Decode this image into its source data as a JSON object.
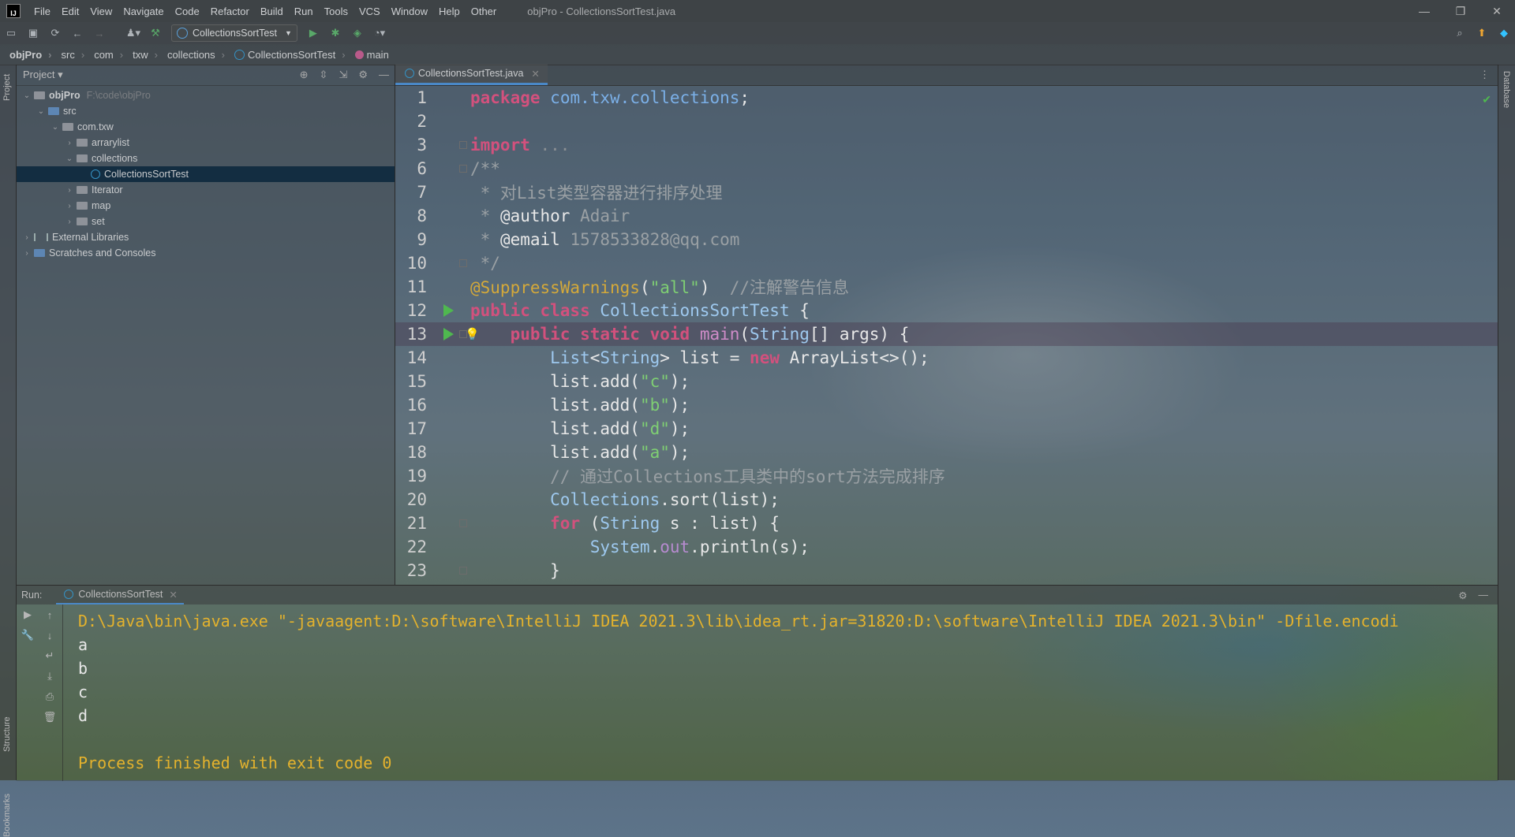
{
  "menubar": {
    "logo": "IJ",
    "items": [
      "File",
      "Edit",
      "View",
      "Navigate",
      "Code",
      "Refactor",
      "Build",
      "Run",
      "Tools",
      "VCS",
      "Window",
      "Help",
      "Other"
    ],
    "window_title": "objPro - CollectionsSortTest.java",
    "controls": [
      "—",
      "❐",
      "✕"
    ]
  },
  "toolbar": {
    "run_config": "CollectionsSortTest"
  },
  "breadcrumb": [
    "objPro",
    "src",
    "com",
    "txw",
    "collections",
    "CollectionsSortTest",
    "main"
  ],
  "left_stripe": {
    "project_label": "Project",
    "structure_label": "Structure",
    "bookmarks_label": "Bookmarks"
  },
  "right_stripe": {
    "database_label": "Database"
  },
  "project_panel": {
    "title": "Project",
    "tree": [
      {
        "label": "objPro",
        "hint": "F:\\code\\objPro",
        "indent": 0,
        "expanded": true,
        "icon": "folder",
        "bold": true
      },
      {
        "label": "src",
        "indent": 1,
        "expanded": true,
        "icon": "folder-blue"
      },
      {
        "label": "com.txw",
        "indent": 2,
        "expanded": true,
        "icon": "folder"
      },
      {
        "label": "arrarylist",
        "indent": 3,
        "expanded": false,
        "icon": "folder"
      },
      {
        "label": "collections",
        "indent": 3,
        "expanded": true,
        "icon": "folder"
      },
      {
        "label": "CollectionsSortTest",
        "indent": 4,
        "icon": "java-class",
        "selected": true
      },
      {
        "label": "Iterator",
        "indent": 3,
        "expanded": false,
        "icon": "folder"
      },
      {
        "label": "map",
        "indent": 3,
        "expanded": false,
        "icon": "folder"
      },
      {
        "label": "set",
        "indent": 3,
        "expanded": false,
        "icon": "folder"
      },
      {
        "label": "External Libraries",
        "indent": 0,
        "expanded": false,
        "icon": "library"
      },
      {
        "label": "Scratches and Consoles",
        "indent": 0,
        "expanded": false,
        "icon": "scratches"
      }
    ]
  },
  "editor": {
    "tab_label": "CollectionsSortTest.java",
    "lines": [
      {
        "n": "1",
        "tokens": [
          [
            "kw",
            "package"
          ],
          [
            "plain",
            " "
          ],
          [
            "pkg",
            "com.txw.collections"
          ],
          [
            "plain",
            ";"
          ]
        ]
      },
      {
        "n": "2",
        "tokens": []
      },
      {
        "n": "3",
        "tokens": [
          [
            "kw",
            "import"
          ],
          [
            "plain",
            " "
          ],
          [
            "cm",
            "..."
          ]
        ],
        "fold": true
      },
      {
        "n": "6",
        "tokens": [
          [
            "cmt",
            "/**"
          ]
        ],
        "fold": true
      },
      {
        "n": "7",
        "tokens": [
          [
            "cmt",
            " * 对List类型容器进行排序处理"
          ]
        ]
      },
      {
        "n": "8",
        "tokens": [
          [
            "cmt",
            " * "
          ],
          [
            "plain",
            "@author"
          ],
          [
            "cmt",
            " Adair"
          ]
        ]
      },
      {
        "n": "9",
        "tokens": [
          [
            "cmt",
            " * "
          ],
          [
            "plain",
            "@email"
          ],
          [
            "cmt",
            " 1578533828@qq.com"
          ]
        ]
      },
      {
        "n": "10",
        "tokens": [
          [
            "cmt",
            " */"
          ]
        ],
        "fold": true
      },
      {
        "n": "11",
        "tokens": [
          [
            "ann",
            "@SuppressWarnings"
          ],
          [
            "plain",
            "("
          ],
          [
            "str",
            "\"all\""
          ],
          [
            "plain",
            ")  "
          ],
          [
            "cmt",
            "//注解警告信息"
          ]
        ]
      },
      {
        "n": "12",
        "tokens": [
          [
            "kw",
            "public class"
          ],
          [
            "plain",
            " "
          ],
          [
            "cls",
            "CollectionsSortTest"
          ],
          [
            "plain",
            " {"
          ]
        ],
        "run": true
      },
      {
        "n": "13",
        "tokens": [
          [
            "plain",
            "    "
          ],
          [
            "kw",
            "public static void"
          ],
          [
            "plain",
            " "
          ],
          [
            "fn",
            "main"
          ],
          [
            "plain",
            "("
          ],
          [
            "cls",
            "String"
          ],
          [
            "plain",
            "[] args) {"
          ]
        ],
        "run": true,
        "current": true,
        "bulb": true,
        "fold": true
      },
      {
        "n": "14",
        "tokens": [
          [
            "plain",
            "        "
          ],
          [
            "cls",
            "List"
          ],
          [
            "plain",
            "<"
          ],
          [
            "cls",
            "String"
          ],
          [
            "plain",
            "> list = "
          ],
          [
            "kw",
            "new"
          ],
          [
            "plain",
            " ArrayList<>();"
          ]
        ]
      },
      {
        "n": "15",
        "tokens": [
          [
            "plain",
            "        list.add("
          ],
          [
            "str",
            "\"c\""
          ],
          [
            "plain",
            ");"
          ]
        ]
      },
      {
        "n": "16",
        "tokens": [
          [
            "plain",
            "        list.add("
          ],
          [
            "str",
            "\"b\""
          ],
          [
            "plain",
            ");"
          ]
        ]
      },
      {
        "n": "17",
        "tokens": [
          [
            "plain",
            "        list.add("
          ],
          [
            "str",
            "\"d\""
          ],
          [
            "plain",
            ");"
          ]
        ]
      },
      {
        "n": "18",
        "tokens": [
          [
            "plain",
            "        list.add("
          ],
          [
            "str",
            "\"a\""
          ],
          [
            "plain",
            ");"
          ]
        ]
      },
      {
        "n": "19",
        "tokens": [
          [
            "plain",
            "        "
          ],
          [
            "cmt",
            "// 通过Collections工具类中的sort方法完成排序"
          ]
        ]
      },
      {
        "n": "20",
        "tokens": [
          [
            "plain",
            "        "
          ],
          [
            "cls",
            "Collections"
          ],
          [
            "plain",
            ".sort(list);"
          ]
        ]
      },
      {
        "n": "21",
        "tokens": [
          [
            "plain",
            "        "
          ],
          [
            "kw",
            "for"
          ],
          [
            "plain",
            " ("
          ],
          [
            "cls",
            "String"
          ],
          [
            "plain",
            " s : list) {"
          ]
        ],
        "fold": true
      },
      {
        "n": "22",
        "tokens": [
          [
            "plain",
            "            "
          ],
          [
            "cls",
            "System"
          ],
          [
            "plain",
            "."
          ],
          [
            "fld",
            "out"
          ],
          [
            "plain",
            ".println(s);"
          ]
        ]
      },
      {
        "n": "23",
        "tokens": [
          [
            "plain",
            "        }"
          ]
        ],
        "fold": true
      }
    ]
  },
  "run_panel": {
    "label": "Run:",
    "tab_label": "CollectionsSortTest",
    "console": [
      {
        "cls": "cmdline",
        "text": "D:\\Java\\bin\\java.exe \"-javaagent:D:\\software\\IntelliJ IDEA 2021.3\\lib\\idea_rt.jar=31820:D:\\software\\IntelliJ IDEA 2021.3\\bin\" -Dfile.encodi"
      },
      {
        "cls": "out",
        "text": "a"
      },
      {
        "cls": "out",
        "text": "b"
      },
      {
        "cls": "out",
        "text": "c"
      },
      {
        "cls": "out",
        "text": "d"
      },
      {
        "cls": "out",
        "text": ""
      },
      {
        "cls": "finish",
        "text": "Process finished with exit code 0"
      }
    ]
  }
}
